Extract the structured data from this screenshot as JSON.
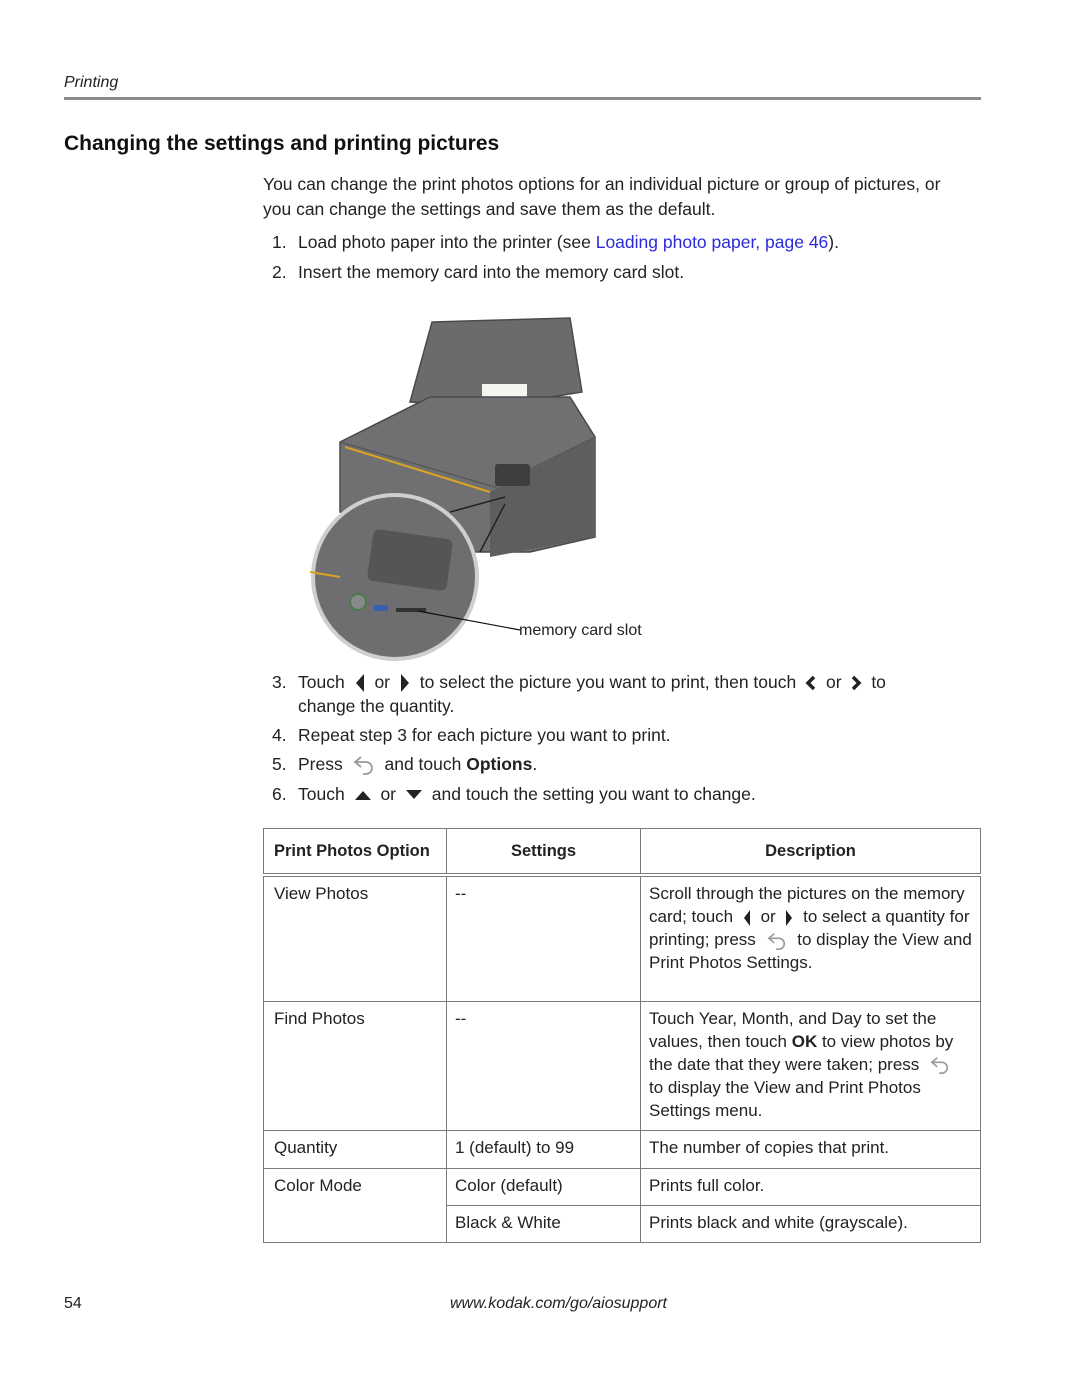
{
  "header": {
    "running_head": "Printing",
    "title": "Changing the settings and printing pictures"
  },
  "intro": "You can change the print photos options for an individual picture or group of pictures, or you can change the settings and save them as the default.",
  "steps": [
    {
      "num": "1.",
      "text_before": "Load photo paper into the printer (see ",
      "link": "Loading photo paper, page 46",
      "text_after": ")."
    },
    {
      "num": "2.",
      "text": "Insert the memory card into the memory card slot."
    },
    {
      "num": "3.",
      "t1": "Touch",
      "t2": "or",
      "t3": "to select the picture you want to print, then touch",
      "t4": "or",
      "t5": "to",
      "t6": "change the quantity.",
      "icons": [
        "left-arrow-icon",
        "right-arrow-icon",
        "left-chevron-icon",
        "right-chevron-icon"
      ]
    },
    {
      "num": "4.",
      "text": "Repeat step 3 for each picture you want to print."
    },
    {
      "num": "5.",
      "t1": "Press",
      "t2": "and touch",
      "bold": "Options",
      "t3": ".",
      "icons": [
        "back-icon"
      ]
    },
    {
      "num": "6.",
      "t1": "Touch",
      "t2": "or",
      "t3": "and touch the setting you want to change.",
      "icons": [
        "up-arrow-icon",
        "down-arrow-icon"
      ]
    }
  ],
  "figure": {
    "alt": "Printer with control panel zoom",
    "callout": "memory card slot"
  },
  "table": {
    "headers": [
      "Print Photos Option",
      "Settings",
      "Description"
    ],
    "rows": [
      {
        "option": "View Photos",
        "setting": "--",
        "desc": {
          "a": "Scroll through the pictures on the memory card; touch",
          "b": "or",
          "c": "to select a quantity for printing; press",
          "d": "to display the View and Print Photos Settings."
        }
      },
      {
        "option": "Find Photos",
        "setting": "--",
        "desc": {
          "a": "Touch Year, Month, and Day to set the values, then touch",
          "bold": "OK",
          "b": "to view photos by the date that they were taken; press",
          "c": "to display the View and Print Photos Settings menu."
        }
      },
      {
        "option": "Quantity",
        "setting": "1 (default) to 99",
        "desc": {
          "a": "The number of copies that print."
        }
      },
      {
        "option": "Color Mode",
        "setting": "Color (default)",
        "desc": {
          "a": "Prints full color."
        }
      },
      {
        "option": "",
        "setting": "Black & White",
        "desc": {
          "a": "Prints black and white (grayscale)."
        }
      }
    ]
  },
  "footer": {
    "page_number": "54",
    "url": "www.kodak.com/go/aiosupport"
  },
  "colors": {
    "link": "#2b2bd9",
    "rule": "#8a8a8a",
    "accent_printer_stripe": "#d9a521"
  }
}
